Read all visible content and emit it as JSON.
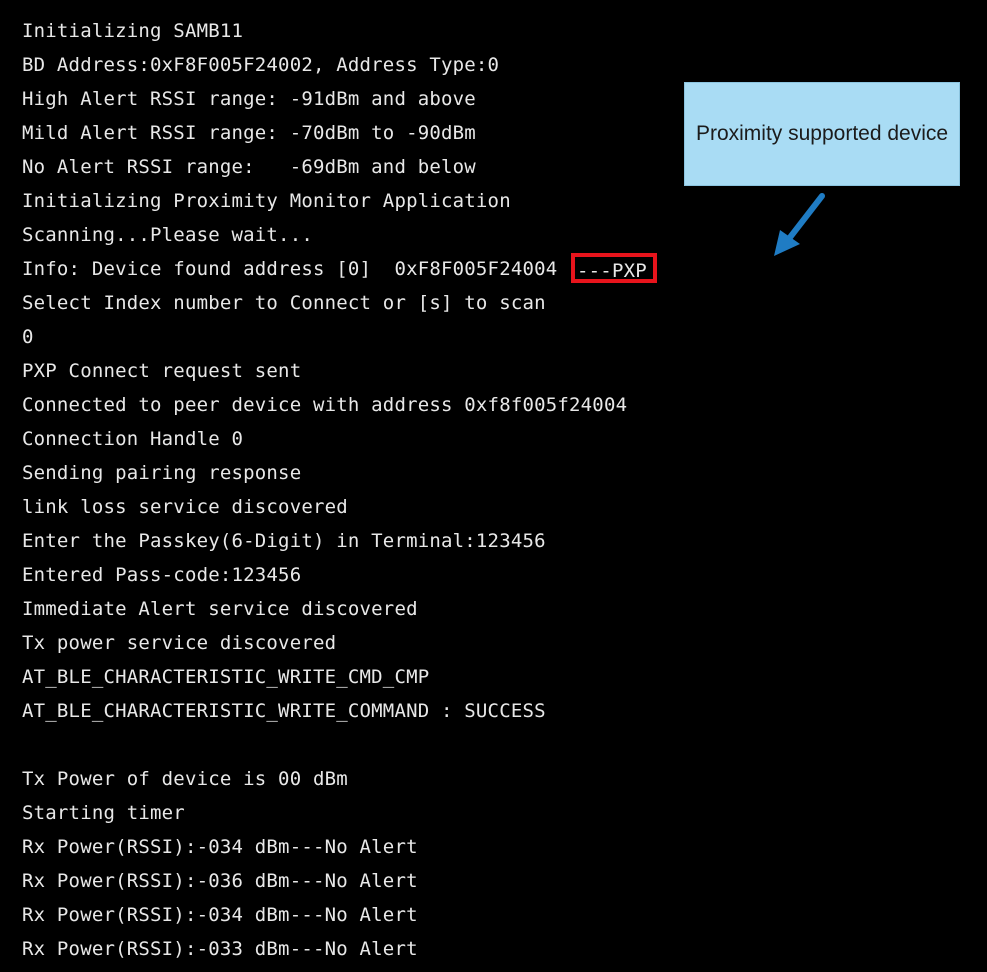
{
  "terminal": {
    "lines": [
      "Initializing SAMB11",
      "BD Address:0xF8F005F24002, Address Type:0",
      "High Alert RSSI range: -91dBm and above",
      "Mild Alert RSSI range: -70dBm to -90dBm",
      "No Alert RSSI range:   -69dBm and below",
      "Initializing Proximity Monitor Application",
      "Scanning...Please wait...",
      "Info: Device found address [0]  0xF8F005F24004 ",
      "Select Index number to Connect or [s] to scan",
      "0",
      "PXP Connect request sent",
      "Connected to peer device with address 0xf8f005f24004",
      "Connection Handle 0",
      "Sending pairing response",
      "link loss service discovered",
      "Enter the Passkey(6-Digit) in Terminal:123456",
      "Entered Pass-code:123456",
      "Immediate Alert service discovered",
      "Tx power service discovered",
      "AT_BLE_CHARACTERISTIC_WRITE_CMD_CMP",
      "AT_BLE_CHARACTERISTIC_WRITE_COMMAND : SUCCESS",
      "",
      "Tx Power of device is 00 dBm",
      "Starting timer",
      "Rx Power(RSSI):-034 dBm---No Alert",
      "Rx Power(RSSI):-036 dBm---No Alert",
      "Rx Power(RSSI):-034 dBm---No Alert",
      "Rx Power(RSSI):-033 dBm---No Alert"
    ],
    "highlighted_suffix": "---PXP",
    "highlight_color": "#e8141c",
    "background_color": "#000000",
    "text_color": "#e8e8e8"
  },
  "callout": {
    "text": "Proximity supported device",
    "background_color": "#a9dcf4",
    "arrow_color": "#1f7cc4"
  }
}
